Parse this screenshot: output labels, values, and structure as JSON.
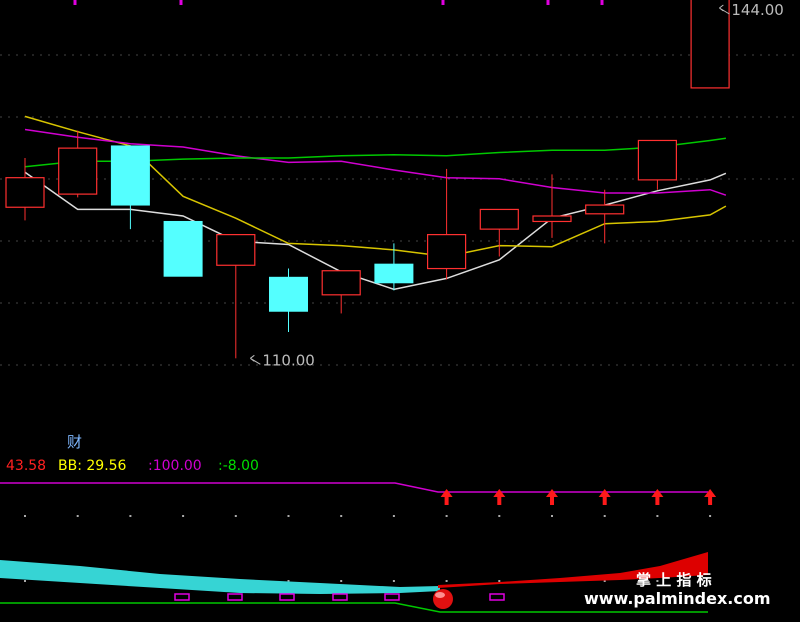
{
  "chart_data": {
    "type": "candlestick",
    "price_scale": {
      "min": 108,
      "max": 146
    },
    "candles": [
      {
        "x": 0,
        "open": 130.5,
        "close": 127.8,
        "high": 132.3,
        "low": 126.6,
        "color": "red"
      },
      {
        "x": 1,
        "open": 133.2,
        "close": 129.0,
        "high": 134.8,
        "low": 128.7,
        "color": "red"
      },
      {
        "x": 2,
        "open": 128.0,
        "close": 133.4,
        "high": 133.4,
        "low": 125.8,
        "color": "cyan"
      },
      {
        "x": 3,
        "open": 121.5,
        "close": 126.5,
        "high": 126.5,
        "low": 121.5,
        "color": "cyan"
      },
      {
        "x": 4,
        "open": 125.3,
        "close": 122.5,
        "high": 125.3,
        "low": 114.0,
        "color": "red"
      },
      {
        "x": 5,
        "open": 118.3,
        "close": 121.4,
        "high": 122.2,
        "low": 116.4,
        "color": "cyan"
      },
      {
        "x": 6,
        "open": 122.0,
        "close": 119.8,
        "high": 122.0,
        "low": 118.1,
        "color": "red"
      },
      {
        "x": 7,
        "open": 120.9,
        "close": 122.6,
        "high": 124.5,
        "low": 120.2,
        "color": "cyan"
      },
      {
        "x": 8,
        "open": 125.3,
        "close": 122.2,
        "high": 131.3,
        "low": 121.2,
        "color": "red"
      },
      {
        "x": 9,
        "open": 127.6,
        "close": 125.8,
        "high": 127.6,
        "low": 123.3,
        "color": "red"
      },
      {
        "x": 10,
        "open": 126.5,
        "close": 127.0,
        "high": 130.8,
        "low": 125.0,
        "color": "red"
      },
      {
        "x": 11,
        "open": 127.2,
        "close": 128.0,
        "high": 129.4,
        "low": 124.5,
        "color": "red"
      },
      {
        "x": 12,
        "open": 130.3,
        "close": 133.9,
        "high": 133.9,
        "low": 129.4,
        "color": "red"
      },
      {
        "x": 13,
        "open": 138.7,
        "close": 147.0,
        "high": 155.0,
        "low": 138.7,
        "color": "red"
      }
    ],
    "moving_averages": [
      {
        "name": "white",
        "color": "#dddddd",
        "x": [
          0,
          1,
          2,
          3,
          4,
          5,
          6,
          7,
          8,
          9,
          10,
          11,
          12,
          13,
          13.3
        ],
        "y": [
          131.0,
          127.6,
          127.6,
          127.0,
          124.7,
          124.4,
          121.9,
          120.3,
          121.3,
          123.0,
          126.8,
          128.0,
          129.3,
          130.3,
          130.9
        ]
      },
      {
        "name": "yellow",
        "color": "#d7c400",
        "x": [
          0,
          1,
          2,
          3,
          4,
          5,
          6,
          7,
          8,
          9,
          10,
          11,
          12,
          13,
          13.3
        ],
        "y": [
          136.1,
          134.7,
          133.4,
          128.8,
          126.8,
          124.5,
          124.3,
          123.9,
          123.3,
          124.3,
          124.2,
          126.3,
          126.5,
          127.1,
          127.9
        ]
      },
      {
        "name": "magenta",
        "color": "#d000d0",
        "x": [
          0,
          1,
          2,
          3,
          4,
          5,
          6,
          7,
          8,
          9,
          10,
          11,
          12,
          13,
          13.3
        ],
        "y": [
          134.9,
          134.2,
          133.6,
          133.3,
          132.5,
          131.9,
          132.0,
          131.2,
          130.5,
          130.4,
          129.6,
          129.1,
          129.1,
          129.4,
          128.9
        ]
      },
      {
        "name": "green",
        "color": "#00c800",
        "x": [
          0,
          1,
          2,
          3,
          4,
          5,
          6,
          7,
          8,
          9,
          10,
          11,
          12,
          13,
          13.3
        ],
        "y": [
          131.5,
          132.0,
          132.0,
          132.2,
          132.3,
          132.3,
          132.5,
          132.6,
          132.5,
          132.8,
          133.0,
          133.0,
          133.3,
          133.9,
          134.1
        ]
      }
    ],
    "annotations": [
      {
        "text": "144.00",
        "price": 146.0,
        "x": 13.1
      },
      {
        "text": "110.00",
        "price": 114.0,
        "x": 4.2
      }
    ],
    "finance_badge": "财",
    "indicator_readout": [
      {
        "text": "43.58",
        "color": "#ff2020"
      },
      {
        "text": "BB: 29.56",
        "color": "#ffff00"
      },
      {
        "text": ":100.00",
        "color": "#d000d0"
      },
      {
        "text": ":-8.00",
        "color": "#00e000"
      }
    ],
    "signal_arrows_x": [
      8,
      9,
      10,
      11,
      12,
      13
    ],
    "watermark": {
      "line1": "掌 上 指 标",
      "line2": "www.palmindex.com"
    }
  }
}
